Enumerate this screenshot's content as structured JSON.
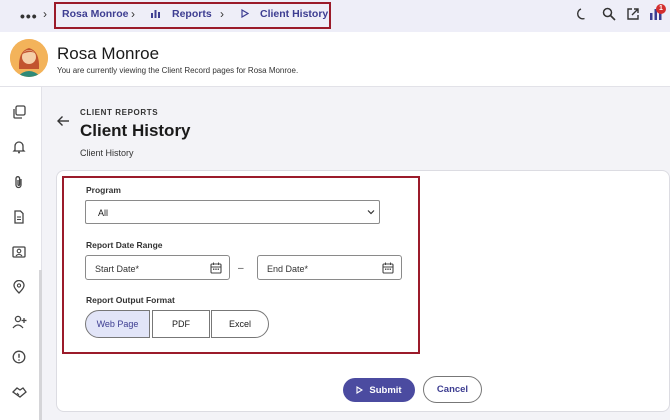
{
  "topbar": {
    "breadcrumb": [
      {
        "label": "Rosa Monroe"
      },
      {
        "label": "Reports"
      },
      {
        "label": "Client History"
      }
    ],
    "notification_count": "1"
  },
  "client": {
    "name": "Rosa Monroe",
    "subtitle": "You are currently viewing the Client Record pages for Rosa Monroe."
  },
  "page": {
    "eyebrow": "CLIENT REPORTS",
    "title": "Client History",
    "subtitle": "Client History"
  },
  "form": {
    "program_label": "Program",
    "program_value": "All",
    "date_range_label": "Report Date Range",
    "start_date_placeholder": "Start Date*",
    "date_separator": "–",
    "end_date_placeholder": "End Date*",
    "output_format_label": "Report Output Format",
    "output_formats": [
      {
        "label": "Web Page",
        "selected": true
      },
      {
        "label": "PDF",
        "selected": false
      },
      {
        "label": "Excel",
        "selected": false
      }
    ]
  },
  "actions": {
    "submit_label": "Submit",
    "cancel_label": "Cancel"
  },
  "icons": {
    "sidebar": [
      "copy-icon",
      "bell-icon",
      "paperclip-icon",
      "document-icon",
      "id-card-icon",
      "location-pin-icon",
      "add-user-icon",
      "alert-icon",
      "handshake-icon"
    ],
    "topbar": [
      "moon-icon",
      "search-icon",
      "external-link-icon",
      "chart-icon"
    ]
  },
  "colors": {
    "accent": "#4b4ba0",
    "highlight_border": "#9b1b2a",
    "badge": "#d32f2f"
  }
}
